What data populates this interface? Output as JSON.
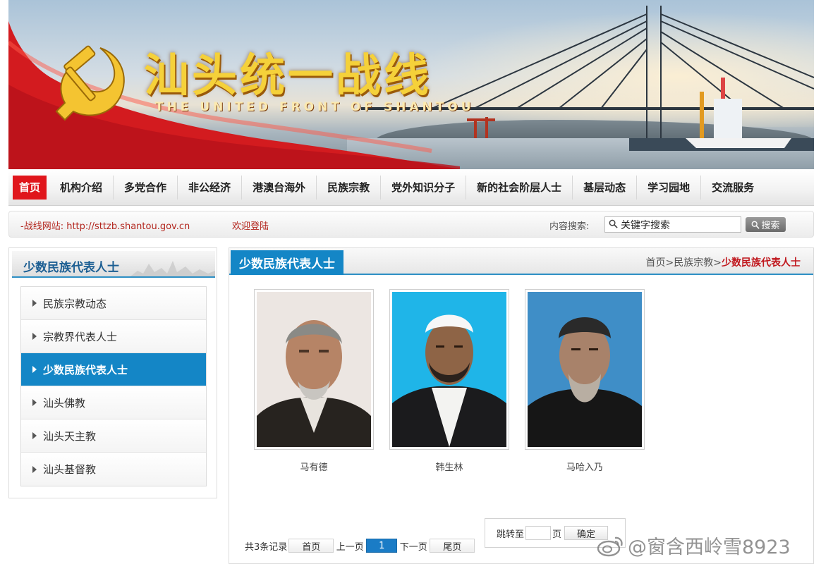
{
  "banner": {
    "title_cn": "汕头统一战线",
    "title_en": "THE UNITED FRONT OF SHANTOU"
  },
  "nav": {
    "items": [
      "首页",
      "机构介绍",
      "多党合作",
      "非公经济",
      "港澳台海外",
      "民族宗教",
      "党外知识分子",
      "新的社会阶层人士",
      "基层动态",
      "学习园地",
      "交流服务"
    ],
    "active_index": 0,
    "active_color": "#e0161c"
  },
  "infobar": {
    "site_text": "-战线网站: http://sttzb.shantou.gov.cn",
    "welcome_text": "欢迎登陆",
    "search_label": "内容搜索:",
    "search_value": "关键字搜索",
    "search_button": "搜索"
  },
  "sidebar": {
    "title": "少数民族代表人士",
    "items": [
      "民族宗教动态",
      "宗教界代表人士",
      "少数民族代表人士",
      "汕头佛教",
      "汕头天主教",
      "汕头基督教"
    ],
    "active_index": 2,
    "accent_color": "#1486c6"
  },
  "main": {
    "tab_title": "少数民族代表人士",
    "breadcrumb": {
      "home": "首页",
      "sep1": ">",
      "section": "民族宗教",
      "sep2": ">",
      "current": "少数民族代表人士"
    },
    "people": [
      {
        "name": "马有德",
        "background": "#ece6e2"
      },
      {
        "name": "韩生林",
        "background": "#1fb5e8"
      },
      {
        "name": "马哈入乃",
        "background": "#3f8ec7"
      }
    ],
    "pager": {
      "total": "共3条记录",
      "first": "首页",
      "prev": "上一页",
      "current": "1",
      "next": "下一页",
      "last": "尾页",
      "jump_label": "跳转至",
      "page_unit": "页",
      "confirm": "确定"
    }
  },
  "watermark": "@窗含西岭雪8923"
}
